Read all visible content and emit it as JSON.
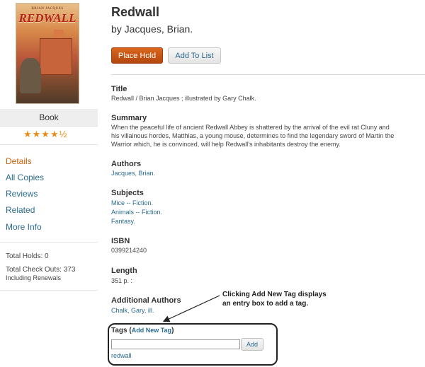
{
  "cover": {
    "author_text": "BRIAN JACQUES",
    "title_text": "REDWALL"
  },
  "format": "Book",
  "rating": {
    "stars_text": "★★★★½",
    "value": 4.5,
    "max": 5,
    "color": "#e88d1a"
  },
  "nav": {
    "items": [
      {
        "label": "Details",
        "active": true
      },
      {
        "label": "All Copies",
        "active": false
      },
      {
        "label": "Reviews",
        "active": false
      },
      {
        "label": "Related",
        "active": false
      },
      {
        "label": "More Info",
        "active": false
      }
    ]
  },
  "stats": {
    "holds": "Total Holds: 0",
    "checkouts": "Total Check Outs: 373",
    "renewals": "Including Renewals"
  },
  "book": {
    "title": "Redwall",
    "byline": "by Jacques, Brian."
  },
  "actions": {
    "place_hold": "Place Hold",
    "add_to_list": "Add To List"
  },
  "details": {
    "title_head": "Title",
    "title_value": "Redwall / Brian Jacques ; illustrated by Gary Chalk.",
    "summary_head": "Summary",
    "summary_lines": [
      "When the peaceful life of ancient Redwall Abbey is shattered by the arrival of the evil rat Cluny and",
      "his villainous hordes, Matthias, a young mouse, determines to find the legendary sword of Martin the",
      "Warrior which, he is convinced, will help Redwall's inhabitants destroy the enemy."
    ],
    "authors_head": "Authors",
    "authors": [
      "Jacques, Brian."
    ],
    "subjects_head": "Subjects",
    "subjects": [
      "Mice -- Fiction.",
      "Animals -- Fiction.",
      "Fantasy."
    ],
    "isbn_head": "ISBN",
    "isbn": "0399214240",
    "length_head": "Length",
    "length": "351 p. :",
    "additional_authors_head": "Additional Authors",
    "additional_authors": [
      "Chalk, Gary, ill."
    ]
  },
  "callout": {
    "line1": "Clicking Add New Tag displays",
    "line2": "an entry box to add a tag."
  },
  "tags": {
    "head": "Tags (",
    "add_new_tag": "Add New Tag",
    "head_close": ")",
    "input_value": "",
    "add_button": "Add",
    "items": [
      "redwall"
    ]
  },
  "colors": {
    "link": "#2a6b8f",
    "active_nav": "#c5620a",
    "hold_button": "#c5560f"
  }
}
